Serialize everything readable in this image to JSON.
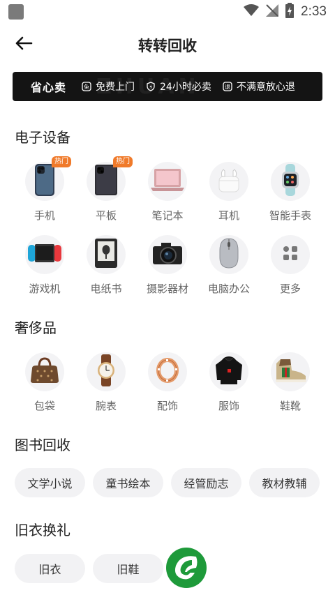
{
  "status_bar": {
    "time": "2:33"
  },
  "header": {
    "title": "转转回收"
  },
  "banner": {
    "brand": "省心卖",
    "features": [
      {
        "label": "免费上门",
        "icon": "exempt-icon"
      },
      {
        "label": "24小时必卖",
        "icon": "shield-lightning-icon"
      },
      {
        "label": "不满意放心退",
        "icon": "return-icon"
      }
    ]
  },
  "electronics": {
    "title": "电子设备",
    "items": [
      {
        "label": "手机",
        "badge": "热门",
        "icon": "phone-icon"
      },
      {
        "label": "平板",
        "badge": "热门",
        "icon": "tablet-icon"
      },
      {
        "label": "笔记本",
        "icon": "laptop-icon"
      },
      {
        "label": "耳机",
        "icon": "earbuds-icon"
      },
      {
        "label": "智能手表",
        "icon": "smartwatch-icon"
      },
      {
        "label": "游戏机",
        "icon": "game-console-icon"
      },
      {
        "label": "电纸书",
        "icon": "ereader-icon"
      },
      {
        "label": "摄影器材",
        "icon": "camera-icon"
      },
      {
        "label": "电脑办公",
        "icon": "mouse-icon"
      },
      {
        "label": "更多",
        "icon": "more-grid-icon"
      }
    ]
  },
  "luxury": {
    "title": "奢侈品",
    "items": [
      {
        "label": "包袋",
        "icon": "handbag-icon"
      },
      {
        "label": "腕表",
        "icon": "wristwatch-icon"
      },
      {
        "label": "配饰",
        "icon": "ring-icon"
      },
      {
        "label": "服饰",
        "icon": "jacket-icon"
      },
      {
        "label": "鞋靴",
        "icon": "sneaker-icon"
      }
    ]
  },
  "books": {
    "title": "图书回收",
    "items": [
      "文学小说",
      "童书绘本",
      "经管励志",
      "教材教辅"
    ]
  },
  "clothes": {
    "title": "旧衣换礼",
    "items": [
      "旧衣",
      "旧鞋"
    ]
  },
  "colors": {
    "badge": "#f07a2a",
    "banner_bg": "#141414",
    "logo_green": "#1e9a3a"
  }
}
